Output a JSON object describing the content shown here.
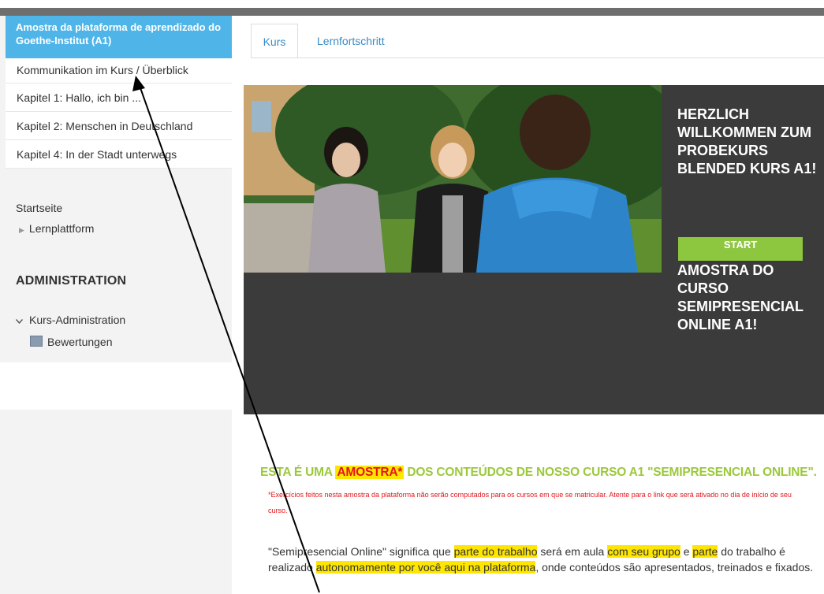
{
  "sidebar": {
    "course_title": "Amostra da plataforma de aprendizado do Goethe-Institut (A1)",
    "nav_items": [
      {
        "label": "Kommunikation im Kurs / Überblick"
      },
      {
        "label": "Kapitel 1: Hallo, ich bin ..."
      },
      {
        "label": "Kapitel 2: Menschen in Deutschland"
      },
      {
        "label": "Kapitel 4: In der Stadt unterwegs"
      }
    ],
    "startseite": "Startseite",
    "lernplattform": "Lernplattform",
    "administration": "ADMINISTRATION",
    "kurs_administration": "Kurs-Administration",
    "bewertungen": "Bewertungen"
  },
  "tabs": [
    {
      "label": "Kurs",
      "active": true
    },
    {
      "label": "Lernfortschritt",
      "active": false
    }
  ],
  "banner": {
    "headline": "HERZLICH WILLKOMMEN ZUM PROBEKURS BLENDED KURS A1!",
    "start_label": "START",
    "subheadline": "AMOSTRA DO CURSO SEMIPRESENCIAL ONLINE A1!"
  },
  "content": {
    "heading_pre": "ESTA É UMA",
    "heading_highlight": "AMOSTRA",
    "heading_star": "*",
    "heading_post": " DOS CONTEÚDOS DE NOSSO CURSO A1 \"SEMIPRESENCIAL ONLINE\".",
    "note": "*Exercícios feitos nesta amostra da plataforma não serão computados para os cursos em que se matricular. Atente para o link que será ativado no dia de início de seu curso.",
    "para": [
      {
        "text": "\"Semipresencial Online\" significa que ",
        "hl": false
      },
      {
        "text": "parte do trabalho",
        "hl": true
      },
      {
        "text": " será em aula ",
        "hl": false
      },
      {
        "text": "com seu grupo",
        "hl": true
      },
      {
        "text": " e ",
        "hl": false
      },
      {
        "text": "parte",
        "hl": true
      },
      {
        "text": " do trabalho é realizado ",
        "hl": false
      },
      {
        "text": "autonomamente por você aqui na plataforma",
        "hl": true
      },
      {
        "text": ", onde conteúdos são apresentados, treinados e fixados.",
        "hl": false
      }
    ]
  },
  "colors": {
    "accent_blue": "#4fb5e9",
    "link_blue": "#3a8cc8",
    "start_green": "#8dc63f",
    "heading_green": "#9bc83a",
    "banner_dark": "#3b3b3b",
    "highlight_yellow": "#ffe600",
    "warning_red": "#e4141b"
  },
  "icons": {
    "lernplattform": "triangle-right-icon",
    "kurs_admin": "chevron-down-icon",
    "bewertungen": "grades-table-icon"
  }
}
